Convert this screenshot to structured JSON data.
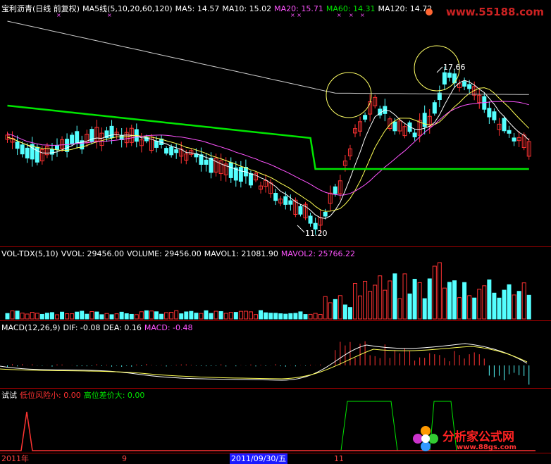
{
  "colors": {
    "up": "#ff3232",
    "down": "#54ffff",
    "ma5": "#ffffff",
    "ma10": "#ffff54",
    "ma20": "#ff54ff",
    "ma60": "#00e600",
    "ma120": "#cccccc",
    "axis": "#b00000",
    "date_highlight": "#1a1aff"
  },
  "price_panel": {
    "stock_name": "宝利沥青(日线 前复权)",
    "ma_label": "MA5线(5,10,20,60,120)",
    "ma5": "MA5: 14.57",
    "ma10": "MA10: 15.02",
    "ma20": "MA20: 15.71",
    "ma60": "MA60: 14.31",
    "ma120": "MA120: 14.72",
    "high_label": "17.66",
    "low_label": "11.20"
  },
  "volume_panel": {
    "name": "VOL-TDX(5,10)",
    "vvol": "VVOL: 29456.00",
    "volume": "VOLUME: 29456.00",
    "mavol1": "MAVOL1: 21081.90",
    "mavol2": "MAVOL2: 25766.22"
  },
  "macd_panel": {
    "name": "MACD(12,26,9)",
    "dif": "DIF: -0.08",
    "dea": "DEA: 0.16",
    "macd": "MACD: -0.48"
  },
  "signal_panel": {
    "name": "试试",
    "low_risk": "低位风险小: 0.00",
    "high_spread": "高位差价大: 0.00"
  },
  "date_axis": {
    "labels": [
      "2011年",
      "9",
      "2011/09/30/五",
      "11"
    ]
  },
  "watermarks": {
    "top_site": "www.55188.com",
    "logo_title": "分析家公式网",
    "logo_url": "www.88gs.com"
  }
}
